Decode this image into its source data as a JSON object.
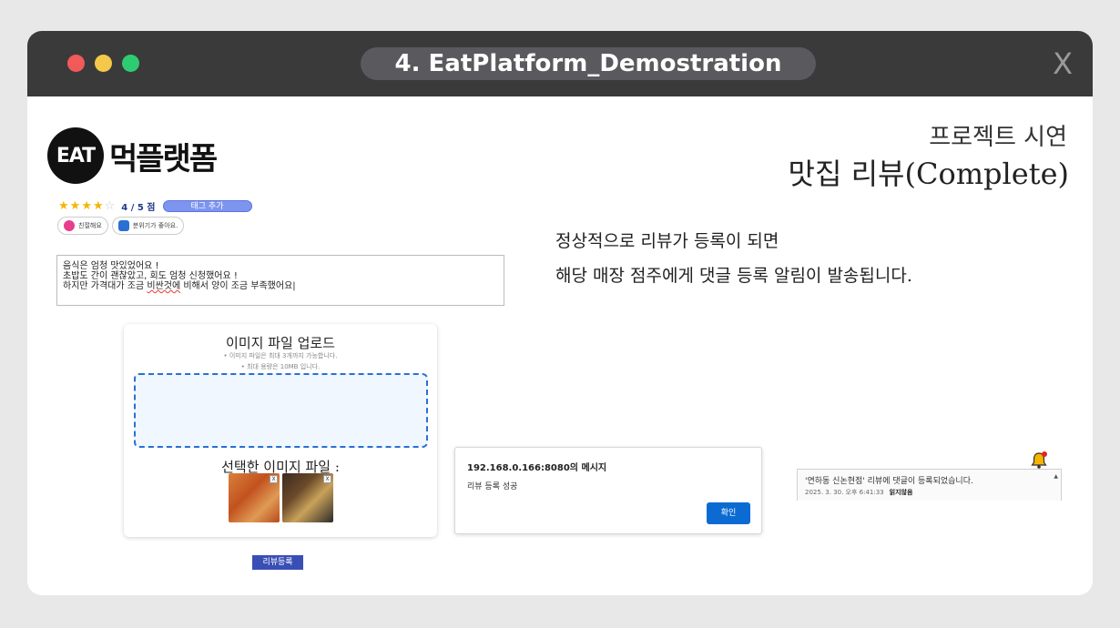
{
  "window": {
    "title": "4. EatPlatform_Demostration",
    "close": "X"
  },
  "logo": {
    "mark": "EAT",
    "text": "먹플랫폼"
  },
  "heading": {
    "small": "프로젝트 시연",
    "big": "맛집 리뷰(Complete)"
  },
  "description": [
    "정상적으로 리뷰가 등록이 되면",
    "해당 매장 점주에게 댓글 등록 알림이 발송됩니다."
  ],
  "review": {
    "stars_filled": 4,
    "stars_total": 5,
    "score_text": "4 / 5 점",
    "tag_button": "태그 추가",
    "chips": [
      "친절해요",
      "분위기가 좋아요."
    ],
    "text_lines": [
      "음식은 엄청 맛있었어요 !",
      "초밥도 간이 괜찮았고, 회도 엄청 신청했어요 !"
    ],
    "line3_before": "하지만 가격대가 조금 ",
    "line3_squiggle": "비싼것에",
    "line3_after": " 비해서 양이 조금 부족했어요|"
  },
  "upload": {
    "title": "이미지 파일 업로드",
    "note1": "• 이미지 파일은 최대 3개까지 가능합니다.",
    "note2": "• 최대 용량은 10MB 입니다.",
    "selected_title": "선택한 이미지 파일 :",
    "delete_mark": "X"
  },
  "submit_button": "리뷰등록",
  "dialog": {
    "title": "192.168.0.166:8080의 메시지",
    "message": "리뷰 등록 성공",
    "ok": "확인"
  },
  "notification": {
    "text": "'연하동 신논현점' 리뷰에 댓글이 등록되었습니다.",
    "time": "2025. 3. 30. 오후 6:41:33",
    "status": "읽지않음",
    "scroll_arrow": "▲"
  },
  "colors": {
    "titlebar": "#3a3a3a",
    "accent_blue": "#0b6bd3",
    "tag_blue": "#7e95f0",
    "star": "#f5b400"
  }
}
